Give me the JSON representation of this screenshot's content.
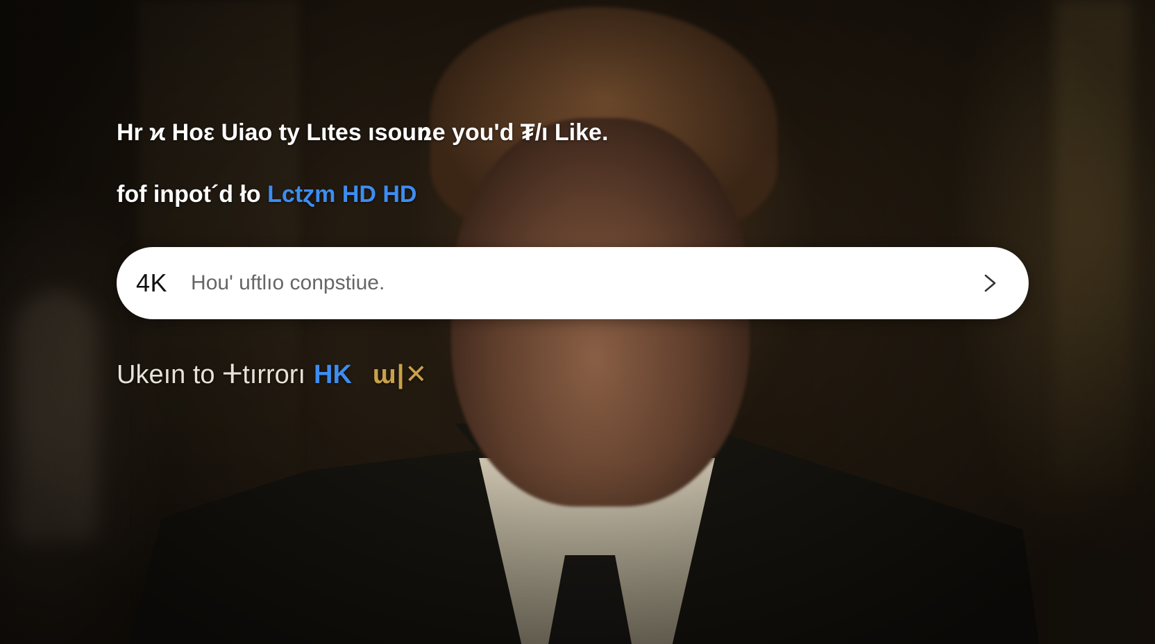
{
  "headline": {
    "line1": "Hr ϰ Hoε Uiao ty Lιtes ısouռe you'd ₮/ı Like.",
    "line2_prefix": "fof inpot´d ło",
    "line2_accent": "Lctɀm HD  HD"
  },
  "search": {
    "badge": "4K",
    "placeholder": "Hou' uftlıo conpstiue.",
    "submit_icon": "chevron-right-icon"
  },
  "footer": {
    "prefix": "Ukeın to ⵜtırrorı",
    "accent_blue": "HK",
    "accent_gold": "ɯ|✕"
  },
  "colors": {
    "accent_blue": "#3d8df0",
    "accent_gold": "#c8a14a",
    "text": "#ffffff",
    "search_bg": "#ffffff"
  },
  "background": {
    "image": "portrait-of-man-in-suit"
  }
}
